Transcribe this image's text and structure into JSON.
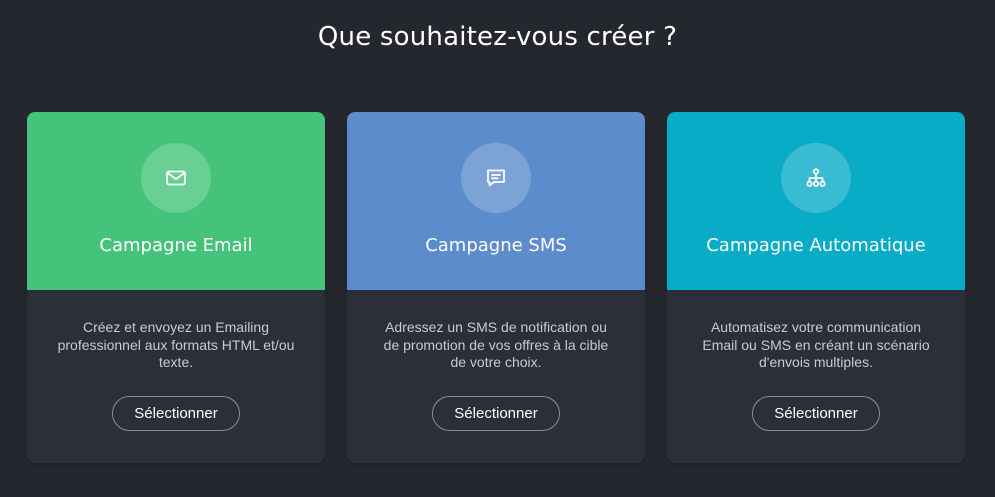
{
  "page": {
    "title": "Que souhaitez-vous créer ?"
  },
  "cards": [
    {
      "title": "Campagne Email",
      "description": "Créez et envoyez un Emailing professionnel aux formats HTML et/ou texte.",
      "button_label": "Sélectionner",
      "icon": "mail-icon",
      "color": "#45c37a"
    },
    {
      "title": "Campagne SMS",
      "description": "Adressez un SMS de notification ou de promotion de vos offres à la cible de votre choix.",
      "button_label": "Sélectionner",
      "icon": "message-icon",
      "color": "#5d8ccc"
    },
    {
      "title": "Campagne Automatique",
      "description": "Automatisez votre communication Email ou SMS en créant un scénario d'envois multiples.",
      "button_label": "Sélectionner",
      "icon": "flow-tree-icon",
      "color": "#08acc7"
    }
  ],
  "colors": {
    "background": "#24272e",
    "card_body": "#2b2f37",
    "text_muted": "#c8cbd1",
    "button_border": "#8a8e96"
  }
}
